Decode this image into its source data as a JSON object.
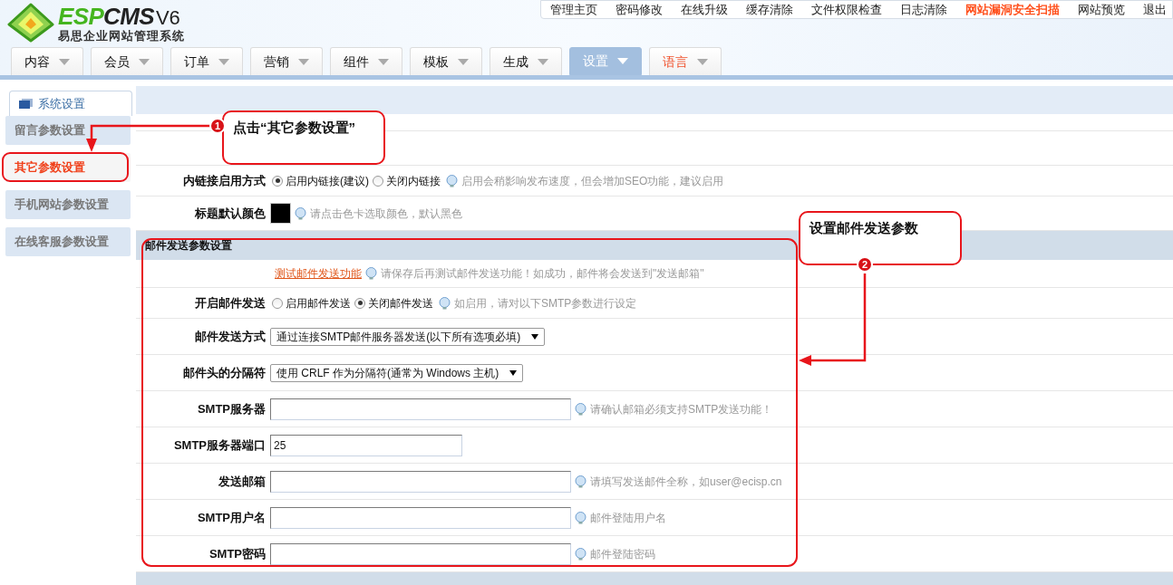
{
  "logo": {
    "brand_green": "ESP",
    "brand_dark": "CMS",
    "version": "V6",
    "subtitle": "易思企业网站管理系统"
  },
  "top_links": [
    {
      "label": "管理主页",
      "highlight": false
    },
    {
      "label": "密码修改",
      "highlight": false
    },
    {
      "label": "在线升级",
      "highlight": false
    },
    {
      "label": "缓存清除",
      "highlight": false
    },
    {
      "label": "文件权限检查",
      "highlight": false
    },
    {
      "label": "日志清除",
      "highlight": false
    },
    {
      "label": "网站漏洞安全扫描",
      "highlight": true
    },
    {
      "label": "网站预览",
      "highlight": false
    },
    {
      "label": "退出",
      "highlight": false
    }
  ],
  "nav_tabs": [
    {
      "label": "内容",
      "selected": false,
      "highlight": false
    },
    {
      "label": "会员",
      "selected": false,
      "highlight": false
    },
    {
      "label": "订单",
      "selected": false,
      "highlight": false
    },
    {
      "label": "营销",
      "selected": false,
      "highlight": false
    },
    {
      "label": "组件",
      "selected": false,
      "highlight": false
    },
    {
      "label": "模板",
      "selected": false,
      "highlight": false
    },
    {
      "label": "生成",
      "selected": false,
      "highlight": false
    },
    {
      "label": "设置",
      "selected": true,
      "highlight": false
    },
    {
      "label": "语言",
      "selected": false,
      "highlight": true
    }
  ],
  "sidebar": {
    "tab": "系统设置",
    "items": [
      {
        "label": "留言参数设置",
        "selected": false
      },
      {
        "label": "其它参数设置",
        "selected": true
      },
      {
        "label": "手机网站参数设置",
        "selected": false
      },
      {
        "label": "在线客服参数设置",
        "selected": false
      }
    ]
  },
  "rows": [
    {
      "kind": "blank"
    },
    {
      "kind": "blank"
    },
    {
      "kind": "radio",
      "label": "内链接启用方式",
      "options": [
        {
          "label": "启用内链接(建议)",
          "selected": true
        },
        {
          "label": "关闭内链接",
          "selected": false
        }
      ],
      "hint": "启用会稍影响发布速度，但会增加SEO功能，建议启用"
    },
    {
      "kind": "color",
      "label": "标题默认颜色",
      "hint": "请点击色卡选取颜色，默认黑色"
    },
    {
      "kind": "section",
      "label": "邮件发送参数设置"
    },
    {
      "kind": "link",
      "link": "测试邮件发送功能",
      "hint": "请保存后再测试邮件发送功能！如成功，邮件将会发送到\"发送邮箱\""
    },
    {
      "kind": "radio",
      "label": "开启邮件发送",
      "options": [
        {
          "label": "启用邮件发送",
          "selected": false
        },
        {
          "label": "关闭邮件发送",
          "selected": true
        }
      ],
      "hint": "如启用，请对以下SMTP参数进行设定"
    },
    {
      "kind": "select",
      "label": "邮件发送方式",
      "value": "通过连接SMTP邮件服务器发送(以下所有选项必填)"
    },
    {
      "kind": "select",
      "label": "邮件头的分隔符",
      "value": "使用 CRLF 作为分隔符(通常为 Windows 主机)"
    },
    {
      "kind": "input",
      "label": "SMTP服务器",
      "value": "",
      "hint": "请确认邮箱必须支持SMTP发送功能！"
    },
    {
      "kind": "short_input",
      "label": "SMTP服务器端口",
      "value": "25"
    },
    {
      "kind": "input",
      "label": "发送邮箱",
      "value": "",
      "hint": "请填写发送邮件全称，如user@ecisp.cn"
    },
    {
      "kind": "input",
      "label": "SMTP用户名",
      "value": "",
      "hint": "邮件登陆用户名"
    },
    {
      "kind": "input",
      "label": "SMTP密码",
      "value": "",
      "hint": "邮件登陆密码"
    },
    {
      "kind": "section_cut"
    }
  ],
  "callouts": [
    {
      "number": "1",
      "text": "点击“其它参数设置”"
    },
    {
      "number": "2",
      "text": "设置邮件发送参数"
    }
  ]
}
